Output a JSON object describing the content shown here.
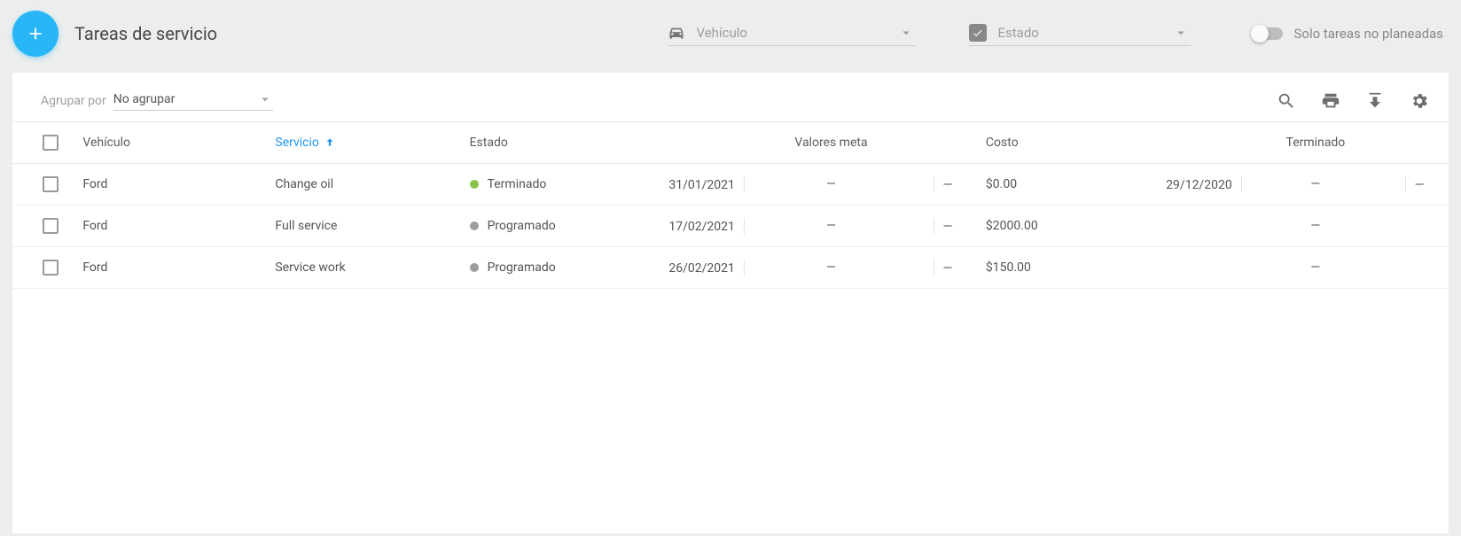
{
  "header": {
    "title": "Tareas de servicio",
    "filters": {
      "vehicle_label": "Vehículo",
      "state_label": "Estado",
      "toggle_label": "Solo tareas no planeadas"
    }
  },
  "card": {
    "group_label": "Agrupar por",
    "group_value": "No agrupar"
  },
  "columns": {
    "vehicle": "Vehículo",
    "service": "Servicio",
    "state": "Estado",
    "targets": "Valores meta",
    "cost": "Costo",
    "finished": "Terminado"
  },
  "rows": [
    {
      "vehicle": "Ford",
      "service": "Change oil",
      "state": "Terminado",
      "status_color": "green",
      "date1": "31/01/2021",
      "targets": "—",
      "extra1": "—",
      "cost": "$0.00",
      "date2": "29/12/2020",
      "finished": "—",
      "extra2": "—"
    },
    {
      "vehicle": "Ford",
      "service": "Full service",
      "state": "Programado",
      "status_color": "gray",
      "date1": "17/02/2021",
      "targets": "—",
      "extra1": "—",
      "cost": "$2000.00",
      "date2": "",
      "finished": "—",
      "extra2": ""
    },
    {
      "vehicle": "Ford",
      "service": "Service work",
      "state": "Programado",
      "status_color": "gray",
      "date1": "26/02/2021",
      "targets": "—",
      "extra1": "—",
      "cost": "$150.00",
      "date2": "",
      "finished": "—",
      "extra2": ""
    }
  ]
}
